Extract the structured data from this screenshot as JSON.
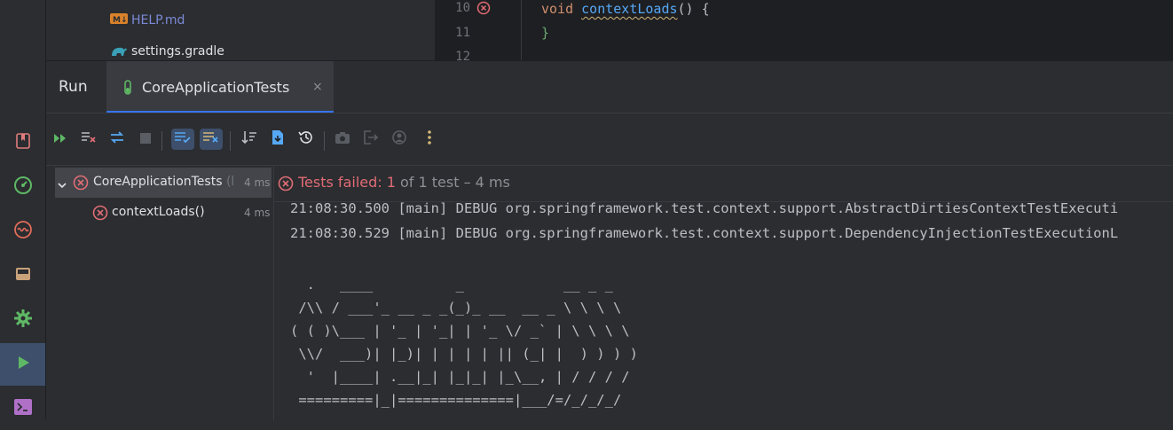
{
  "project_tree": {
    "items": [
      {
        "label": "HELP.md",
        "icon": "markdown-icon"
      },
      {
        "label": "settings.gradle",
        "icon": "gradle-icon"
      }
    ]
  },
  "editor": {
    "line_numbers": [
      "10",
      "11",
      "12"
    ],
    "code_lines": [
      {
        "keyword": "void",
        "function": "contextLoads",
        "rest": "() {"
      },
      {
        "text": "}"
      }
    ]
  },
  "run_panel": {
    "title": "Run",
    "tab_label": "CoreApplicationTests",
    "tab_close": "×"
  },
  "test_tree": {
    "root": {
      "name": "CoreApplicationTests",
      "suffix": "(hel",
      "time": "4 ms",
      "status": "failed"
    },
    "child": {
      "name": "contextLoads()",
      "time": "4 ms",
      "status": "failed"
    }
  },
  "status": {
    "failed_label": "Tests failed: 1",
    "rest": " of 1 test – 4 ms"
  },
  "console": {
    "lines": [
      "21:08:30.500 [main] DEBUG org.springframework.test.context.support.AbstractDirtiesContextTestExecuti",
      "21:08:30.529 [main] DEBUG org.springframework.test.context.support.DependencyInjectionTestExecutionL",
      "",
      "  .   ____          _            __ _ _",
      " /\\\\ / ___'_ __ _ _(_)_ __  __ _ \\ \\ \\ \\",
      "( ( )\\___ | '_ | '_| | '_ \\/ _` | \\ \\ \\ \\",
      " \\\\/  ___)| |_)| | | | | || (_| |  ) ) ) )",
      "  '  |____| .__|_| |_|_| |_\\__, | / / / /",
      " =========|_|==============|___/=/_/_/_/"
    ]
  },
  "colors": {
    "accent": "#3574f0",
    "error": "#e06c75",
    "run_green": "#5fb865"
  }
}
